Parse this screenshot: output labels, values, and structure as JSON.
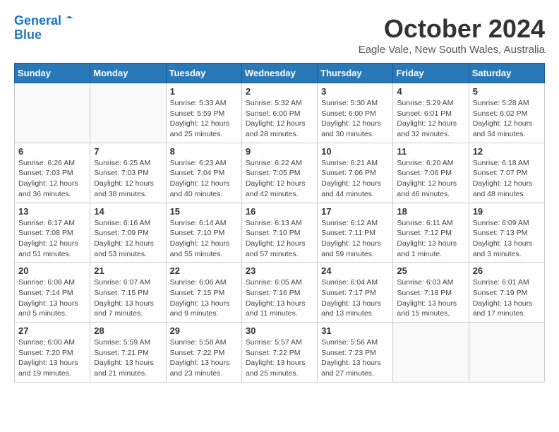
{
  "header": {
    "logo_line1": "General",
    "logo_line2": "Blue",
    "month_title": "October 2024",
    "location": "Eagle Vale, New South Wales, Australia"
  },
  "calendar": {
    "weekdays": [
      "Sunday",
      "Monday",
      "Tuesday",
      "Wednesday",
      "Thursday",
      "Friday",
      "Saturday"
    ],
    "weeks": [
      [
        {
          "day": "",
          "info": ""
        },
        {
          "day": "",
          "info": ""
        },
        {
          "day": "1",
          "info": "Sunrise: 5:33 AM\nSunset: 5:59 PM\nDaylight: 12 hours\nand 25 minutes."
        },
        {
          "day": "2",
          "info": "Sunrise: 5:32 AM\nSunset: 6:00 PM\nDaylight: 12 hours\nand 28 minutes."
        },
        {
          "day": "3",
          "info": "Sunrise: 5:30 AM\nSunset: 6:00 PM\nDaylight: 12 hours\nand 30 minutes."
        },
        {
          "day": "4",
          "info": "Sunrise: 5:29 AM\nSunset: 6:01 PM\nDaylight: 12 hours\nand 32 minutes."
        },
        {
          "day": "5",
          "info": "Sunrise: 5:28 AM\nSunset: 6:02 PM\nDaylight: 12 hours\nand 34 minutes."
        }
      ],
      [
        {
          "day": "6",
          "info": "Sunrise: 6:26 AM\nSunset: 7:03 PM\nDaylight: 12 hours\nand 36 minutes."
        },
        {
          "day": "7",
          "info": "Sunrise: 6:25 AM\nSunset: 7:03 PM\nDaylight: 12 hours\nand 38 minutes."
        },
        {
          "day": "8",
          "info": "Sunrise: 6:23 AM\nSunset: 7:04 PM\nDaylight: 12 hours\nand 40 minutes."
        },
        {
          "day": "9",
          "info": "Sunrise: 6:22 AM\nSunset: 7:05 PM\nDaylight: 12 hours\nand 42 minutes."
        },
        {
          "day": "10",
          "info": "Sunrise: 6:21 AM\nSunset: 7:06 PM\nDaylight: 12 hours\nand 44 minutes."
        },
        {
          "day": "11",
          "info": "Sunrise: 6:20 AM\nSunset: 7:06 PM\nDaylight: 12 hours\nand 46 minutes."
        },
        {
          "day": "12",
          "info": "Sunrise: 6:18 AM\nSunset: 7:07 PM\nDaylight: 12 hours\nand 48 minutes."
        }
      ],
      [
        {
          "day": "13",
          "info": "Sunrise: 6:17 AM\nSunset: 7:08 PM\nDaylight: 12 hours\nand 51 minutes."
        },
        {
          "day": "14",
          "info": "Sunrise: 6:16 AM\nSunset: 7:09 PM\nDaylight: 12 hours\nand 53 minutes."
        },
        {
          "day": "15",
          "info": "Sunrise: 6:14 AM\nSunset: 7:10 PM\nDaylight: 12 hours\nand 55 minutes."
        },
        {
          "day": "16",
          "info": "Sunrise: 6:13 AM\nSunset: 7:10 PM\nDaylight: 12 hours\nand 57 minutes."
        },
        {
          "day": "17",
          "info": "Sunrise: 6:12 AM\nSunset: 7:11 PM\nDaylight: 12 hours\nand 59 minutes."
        },
        {
          "day": "18",
          "info": "Sunrise: 6:11 AM\nSunset: 7:12 PM\nDaylight: 13 hours\nand 1 minute."
        },
        {
          "day": "19",
          "info": "Sunrise: 6:09 AM\nSunset: 7:13 PM\nDaylight: 13 hours\nand 3 minutes."
        }
      ],
      [
        {
          "day": "20",
          "info": "Sunrise: 6:08 AM\nSunset: 7:14 PM\nDaylight: 13 hours\nand 5 minutes."
        },
        {
          "day": "21",
          "info": "Sunrise: 6:07 AM\nSunset: 7:15 PM\nDaylight: 13 hours\nand 7 minutes."
        },
        {
          "day": "22",
          "info": "Sunrise: 6:06 AM\nSunset: 7:15 PM\nDaylight: 13 hours\nand 9 minutes."
        },
        {
          "day": "23",
          "info": "Sunrise: 6:05 AM\nSunset: 7:16 PM\nDaylight: 13 hours\nand 11 minutes."
        },
        {
          "day": "24",
          "info": "Sunrise: 6:04 AM\nSunset: 7:17 PM\nDaylight: 13 hours\nand 13 minutes."
        },
        {
          "day": "25",
          "info": "Sunrise: 6:03 AM\nSunset: 7:18 PM\nDaylight: 13 hours\nand 15 minutes."
        },
        {
          "day": "26",
          "info": "Sunrise: 6:01 AM\nSunset: 7:19 PM\nDaylight: 13 hours\nand 17 minutes."
        }
      ],
      [
        {
          "day": "27",
          "info": "Sunrise: 6:00 AM\nSunset: 7:20 PM\nDaylight: 13 hours\nand 19 minutes."
        },
        {
          "day": "28",
          "info": "Sunrise: 5:59 AM\nSunset: 7:21 PM\nDaylight: 13 hours\nand 21 minutes."
        },
        {
          "day": "29",
          "info": "Sunrise: 5:58 AM\nSunset: 7:22 PM\nDaylight: 13 hours\nand 23 minutes."
        },
        {
          "day": "30",
          "info": "Sunrise: 5:57 AM\nSunset: 7:22 PM\nDaylight: 13 hours\nand 25 minutes."
        },
        {
          "day": "31",
          "info": "Sunrise: 5:56 AM\nSunset: 7:23 PM\nDaylight: 13 hours\nand 27 minutes."
        },
        {
          "day": "",
          "info": ""
        },
        {
          "day": "",
          "info": ""
        }
      ]
    ]
  }
}
